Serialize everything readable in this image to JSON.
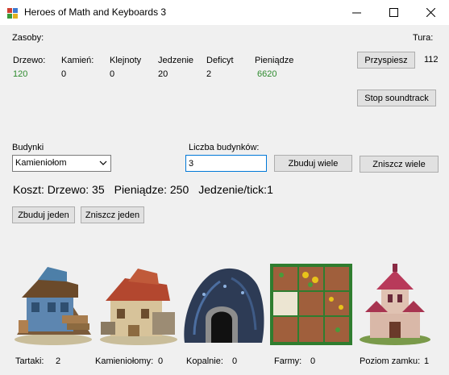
{
  "window": {
    "title": "Heroes of Math and Keyboards 3"
  },
  "resources": {
    "header": "Zasoby:",
    "items": [
      {
        "label": "Drzewo:",
        "value": "120"
      },
      {
        "label": "Kamień:",
        "value": "0"
      },
      {
        "label": "Klejnoty",
        "value": "0"
      },
      {
        "label": "Jedzenie",
        "value": "20"
      },
      {
        "label": "Deficyt",
        "value": "2"
      },
      {
        "label": "Pieniądze",
        "value": "6620"
      }
    ]
  },
  "turn": {
    "label": "Tura:",
    "value": "112",
    "speedup_label": "Przyspiesz"
  },
  "soundtrack": {
    "stop_label": "Stop soundtrack"
  },
  "buildings": {
    "label": "Budynki",
    "selected": "Kamieniołom",
    "count_label": "Liczba budynków:",
    "count_value": "3",
    "build_many_label": "Zbuduj wiele",
    "destroy_many_label": "Zniszcz wiele",
    "build_one_label": "Zbuduj jeden",
    "destroy_one_label": "Zniszcz jeden"
  },
  "cost": {
    "wood": "Koszt: Drzewo: 35",
    "money": "Pieniądze: 250",
    "food": "Jedzenie/tick:1"
  },
  "counts": [
    {
      "label": "Tartaki:",
      "value": "2",
      "icon": "sawmill-icon"
    },
    {
      "label": "Kamieniołomy:",
      "value": "0",
      "icon": "quarry-icon"
    },
    {
      "label": "Kopalnie:",
      "value": "0",
      "icon": "mine-icon"
    },
    {
      "label": "Farmy:",
      "value": "0",
      "icon": "farm-icon"
    },
    {
      "label": "Poziom zamku:",
      "value": "1",
      "icon": "castle-icon"
    }
  ],
  "colors": {
    "accent_green": "#2e8b2e",
    "focus_border": "#0078d7",
    "farm_border": "#2f7d2f"
  }
}
